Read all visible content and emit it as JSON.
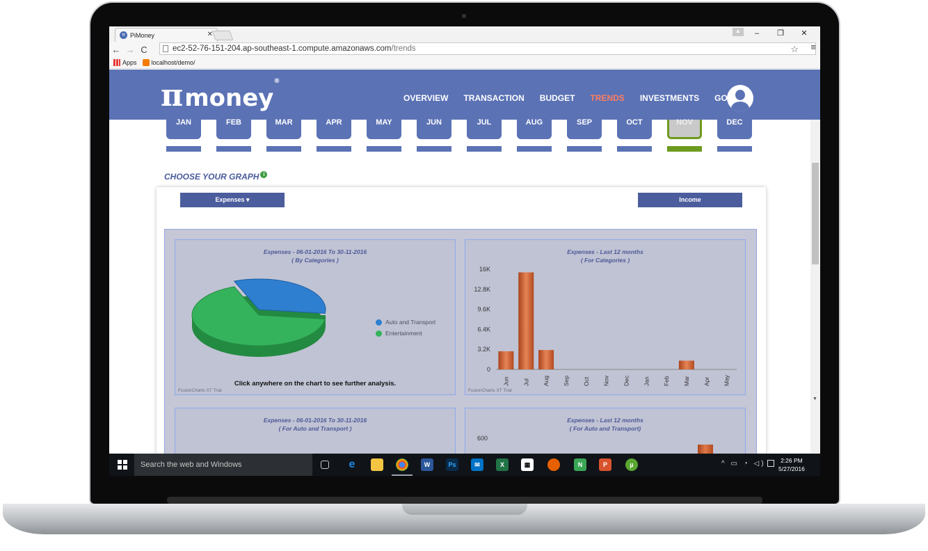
{
  "browser": {
    "tab_title": "PiMoney",
    "url_host": "ec2-52-76-151-204.ap-southeast-1.compute.amazonaws.com",
    "url_path": "/trends",
    "bookmarks": [
      "Apps",
      "localhost/demo/"
    ]
  },
  "site": {
    "logo_text": "money",
    "nav": [
      {
        "label": "OVERVIEW",
        "active": false
      },
      {
        "label": "TRANSACTION",
        "active": false
      },
      {
        "label": "BUDGET",
        "active": false
      },
      {
        "label": "TRENDS",
        "active": true
      },
      {
        "label": "INVESTMENTS",
        "active": false
      },
      {
        "label": "GOALS",
        "active": false
      }
    ]
  },
  "months": {
    "items": [
      "JAN",
      "FEB",
      "MAR",
      "APR",
      "MAY",
      "JUN",
      "JUL",
      "AUG",
      "SEP",
      "OCT",
      "NOV",
      "DEC"
    ],
    "selected": "NOV"
  },
  "choose_graph": {
    "title": "CHOOSE YOUR GRAPH",
    "expenses_label": "Expenses",
    "income_label": "Income"
  },
  "colors": {
    "header": "#5b72b5",
    "accent_active": "#ff7e5f",
    "selected_month": "#6d9b1e",
    "bar": "#c8592a"
  },
  "chart_data": [
    {
      "type": "pie",
      "title": "Expenses - 06-01-2016 To 30-11-2016",
      "subtitle": "( By Categories )",
      "slices": [
        {
          "name": "Auto and Transport",
          "value": 33,
          "color": "#2f7fd0"
        },
        {
          "name": "Entertainment",
          "value": 67,
          "color": "#35b35c"
        }
      ],
      "hint": "Click anywhere on the chart to see further analysis.",
      "watermark": "FusionCharts XT Trial"
    },
    {
      "type": "bar",
      "title": "Expenses - Last 12 months",
      "subtitle": "( For Categories )",
      "categories": [
        "Jun",
        "Jul",
        "Aug",
        "Sep",
        "Oct",
        "Nov",
        "Dec",
        "Jan",
        "Feb",
        "Mar",
        "Apr",
        "May"
      ],
      "values": [
        2900,
        15500,
        3100,
        0,
        0,
        0,
        0,
        0,
        0,
        1400,
        0,
        0
      ],
      "yticks": [
        "16K",
        "12.8K",
        "9.6K",
        "6.4K",
        "3.2K",
        "0"
      ],
      "ylim": [
        0,
        16000
      ],
      "watermark": "FusionCharts XT Trial"
    },
    {
      "type": "pie",
      "title": "Expenses - 06-01-2016 To 30-11-2016",
      "subtitle": "( For Auto and Transport )"
    },
    {
      "type": "bar",
      "title": "Expenses - Last 12 months",
      "subtitle": "( For Auto and Transport)",
      "yticks": [
        "600"
      ]
    }
  ],
  "taskbar": {
    "search_placeholder": "Search the web and Windows",
    "time": "2:26 PM",
    "date": "5/27/2016"
  }
}
